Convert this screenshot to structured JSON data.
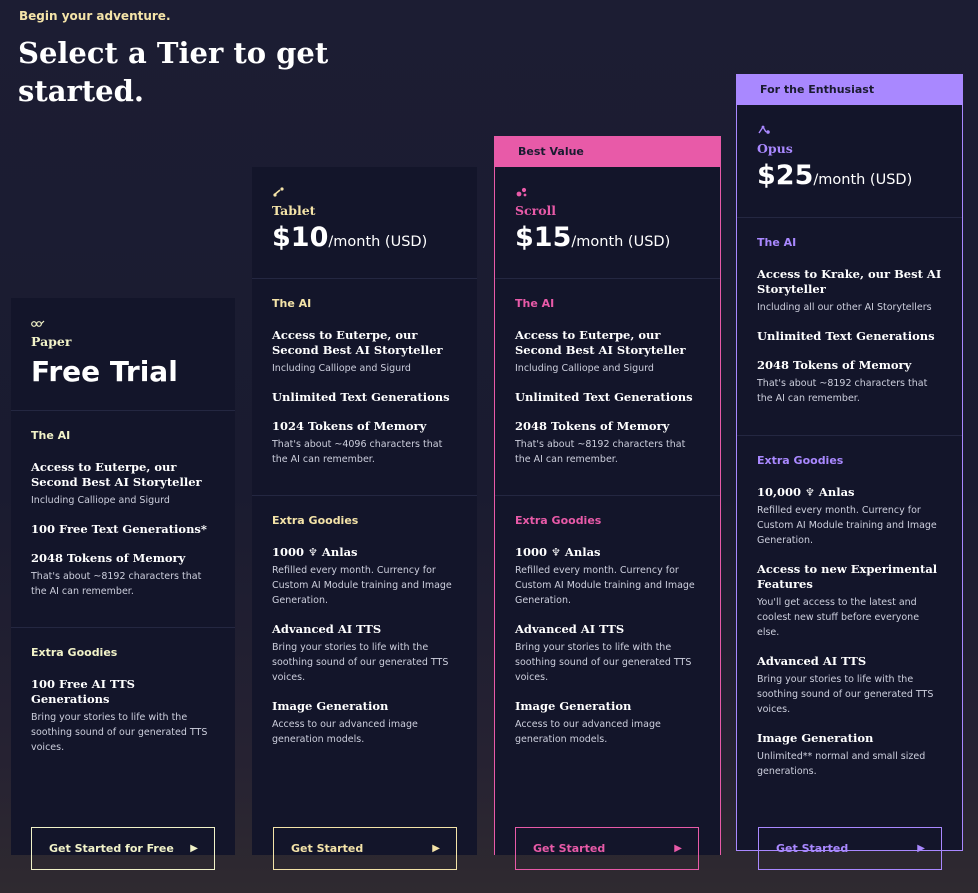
{
  "header": {
    "eyebrow": "Begin your adventure.",
    "title": "Select a Tier to get started."
  },
  "colors": {
    "paper": "#f1f2c8",
    "tablet": "#f4e3a8",
    "scroll": "#e85aa8",
    "opus": "#a988ff",
    "card_bg": "#13152a",
    "page_bg": "#1c1d33"
  },
  "tiers": {
    "paper": {
      "icon": "paper-icon",
      "name": "Paper",
      "title": "Free Trial",
      "ai_label": "The AI",
      "f1_title": "Access to Euterpe, our Second Best AI Storyteller",
      "f1_desc": "Including Calliope and Sigurd",
      "f2_title": "100 Free Text Generations*",
      "f3_title": "2048 Tokens of Memory",
      "f3_desc": "That's about ~8192 characters that the AI can remember.",
      "extra_label": "Extra Goodies",
      "e1_title": "100 Free AI TTS Generations",
      "e1_desc": "Bring your stories to life with the soothing sound of our generated TTS voices.",
      "cta": "Get Started for Free"
    },
    "tablet": {
      "icon": "tablet-icon",
      "name": "Tablet",
      "price": "$10",
      "per": "/month (USD)",
      "ai_label": "The AI",
      "f1_title": "Access to Euterpe, our Second Best AI Storyteller",
      "f1_desc": "Including Calliope and Sigurd",
      "f2_title": "Unlimited Text Generations",
      "f3_title": "1024 Tokens of Memory",
      "f3_desc": "That's about ~4096 characters that the AI can remember.",
      "extra_label": "Extra Goodies",
      "e1_amount": "1000",
      "e1_unit": "Anlas",
      "e1_desc": "Refilled every month. Currency for Custom AI Module training and Image Generation.",
      "e2_title": "Advanced AI TTS",
      "e2_desc": "Bring your stories to life with the soothing sound of our generated TTS voices.",
      "e3_title": "Image Generation",
      "e3_desc": "Access to our advanced image generation models.",
      "cta": "Get Started"
    },
    "scroll": {
      "ribbon": "Best Value",
      "icon": "scroll-icon",
      "name": "Scroll",
      "price": "$15",
      "per": "/month (USD)",
      "ai_label": "The AI",
      "f1_title": "Access to Euterpe, our Second Best AI Storyteller",
      "f1_desc": "Including Calliope and Sigurd",
      "f2_title": "Unlimited Text Generations",
      "f3_title": "2048 Tokens of Memory",
      "f3_desc": "That's about ~8192 characters that the AI can remember.",
      "extra_label": "Extra Goodies",
      "e1_amount": "1000",
      "e1_unit": "Anlas",
      "e1_desc": "Refilled every month. Currency for Custom AI Module training and Image Generation.",
      "e2_title": "Advanced AI TTS",
      "e2_desc": "Bring your stories to life with the soothing sound of our generated TTS voices.",
      "e3_title": "Image Generation",
      "e3_desc": "Access to our advanced image generation models.",
      "cta": "Get Started"
    },
    "opus": {
      "ribbon": "For the Enthusiast",
      "icon": "opus-icon",
      "name": "Opus",
      "price": "$25",
      "per": "/month (USD)",
      "ai_label": "The AI",
      "f1_title": "Access to Krake, our Best AI Storyteller",
      "f1_desc": "Including all our other AI Storytellers",
      "f2_title": "Unlimited Text Generations",
      "f3_title": "2048 Tokens of Memory",
      "f3_desc": "That's about ~8192 characters that the AI can remember.",
      "extra_label": "Extra Goodies",
      "e1_amount": "10,000",
      "e1_unit": "Anlas",
      "e1_desc": "Refilled every month. Currency for Custom AI Module training and Image Generation.",
      "e4_title": "Access to new Experimental Features",
      "e4_desc": "You'll get access to the latest and coolest new stuff before everyone else.",
      "e2_title": "Advanced AI TTS",
      "e2_desc": "Bring your stories to life with the soothing sound of our generated TTS voices.",
      "e3_title": "Image Generation",
      "e3_desc": "Unlimited** normal and small sized generations.",
      "cta": "Get Started"
    }
  }
}
